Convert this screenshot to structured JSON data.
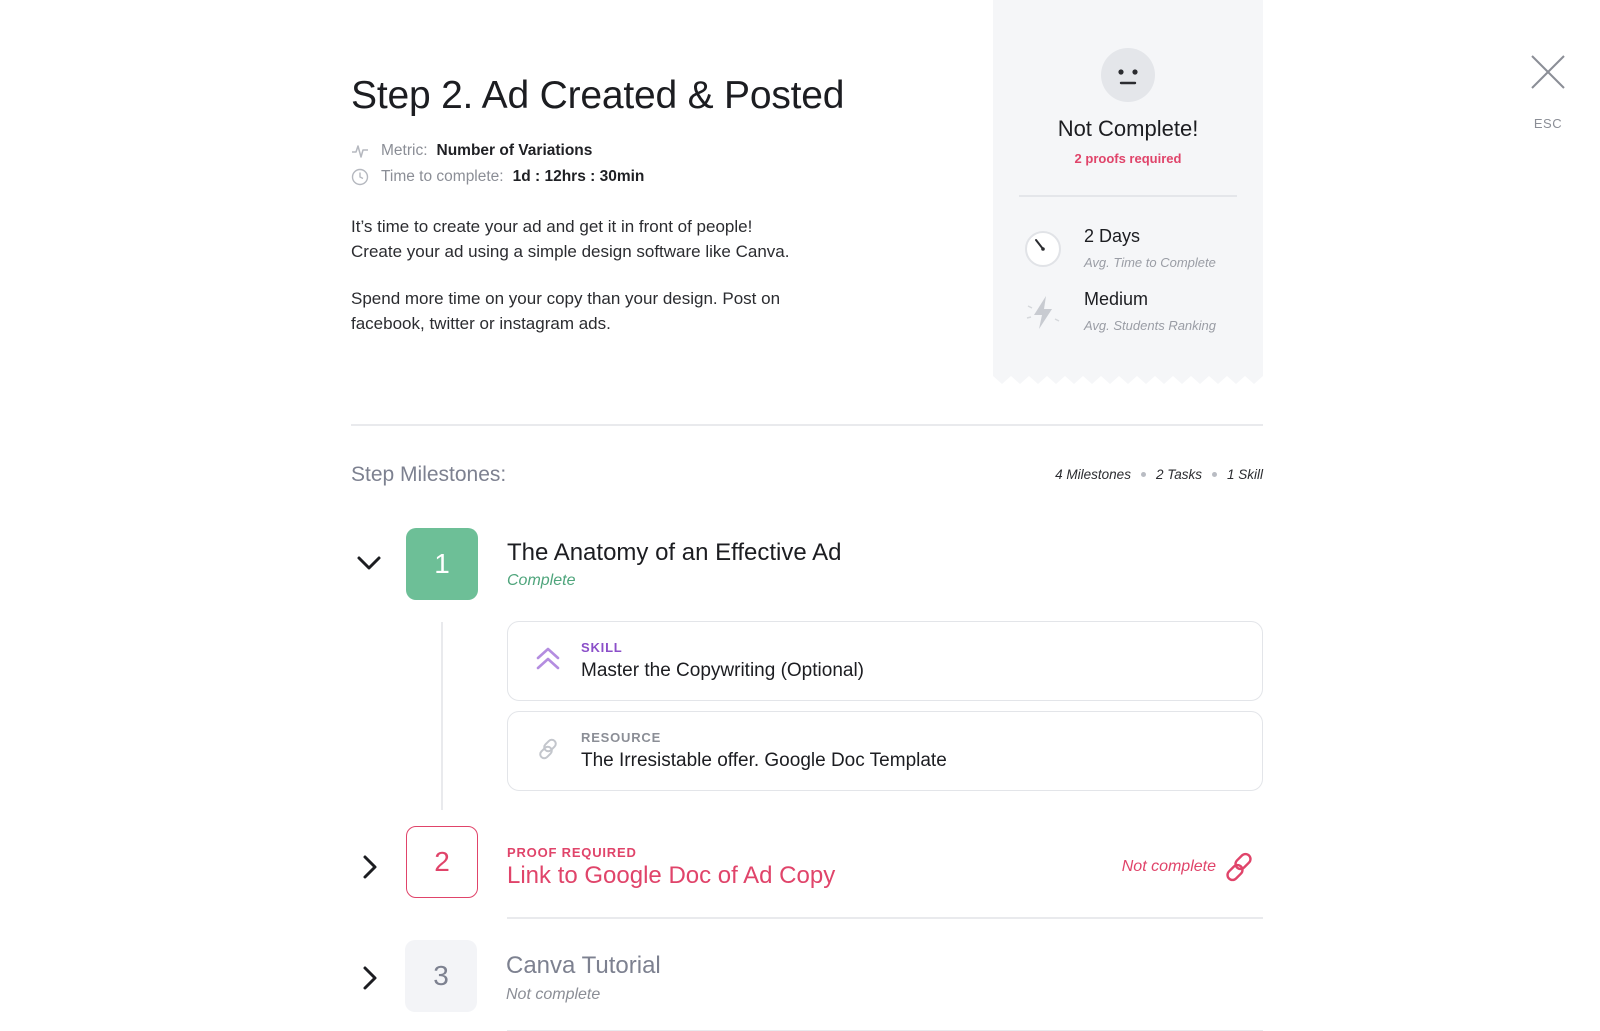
{
  "close": {
    "esc_label": "ESC"
  },
  "step": {
    "title": "Step 2. Ad Created & Posted",
    "metric_label": "Metric:",
    "metric_value": "Number of Variations",
    "time_label": "Time to complete:",
    "time_value": "1d : 12hrs : 30min",
    "description": [
      "It’s time to create your ad and get it in front of people!",
      "Create your ad using a simple design software like Canva.",
      "Spend more time on your copy than your design. Post on",
      "facebook, twitter or instagram ads."
    ]
  },
  "status_card": {
    "status": "Not Complete!",
    "proofs": "2 proofs required",
    "stats": [
      {
        "icon": "stopwatch-icon",
        "value": "2 Days",
        "label": "Avg. Time to Complete"
      },
      {
        "icon": "lightning-icon",
        "value": "Medium",
        "label": "Avg. Students Ranking"
      }
    ]
  },
  "milestones_section": {
    "heading": "Step Milestones:",
    "counts": [
      "4 Milestones",
      "2 Tasks",
      "1 Skill"
    ]
  },
  "milestones": [
    {
      "number": "1",
      "title": "The Anatomy of an Effective Ad",
      "status": "Complete",
      "expanded": true,
      "items": [
        {
          "type": "SKILL",
          "title": "Master the Copywriting (Optional)",
          "icon": "double-chevron-up-icon"
        },
        {
          "type": "RESOURCE",
          "title": "The Irresistable offer. Google Doc Template",
          "icon": "link-icon"
        }
      ]
    },
    {
      "number": "2",
      "label": "PROOF REQUIRED",
      "title": "Link to Google Doc of Ad Copy",
      "status": "Not complete",
      "expanded": false
    },
    {
      "number": "3",
      "title": "Canva Tutorial",
      "status": "Not complete",
      "expanded": false
    }
  ],
  "colors": {
    "complete_green": "#6dbf97",
    "proof_red": "#e0446a",
    "skill_purple": "#8b4fc9",
    "muted_gray": "#7d8190"
  }
}
